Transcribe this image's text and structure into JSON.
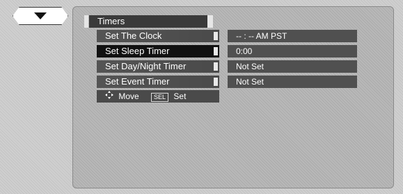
{
  "menu": {
    "title": "Timers",
    "items": [
      {
        "label": "Set The Clock",
        "value": "-- : -- AM PST",
        "selected": false
      },
      {
        "label": "Set Sleep Timer",
        "value": "0:00",
        "selected": true
      },
      {
        "label": "Set Day/Night Timer",
        "value": "Not Set",
        "selected": false
      },
      {
        "label": "Set Event Timer",
        "value": "Not Set",
        "selected": false
      }
    ]
  },
  "hint": {
    "move_label": "Move",
    "sel_key": "SEL",
    "set_label": "Set"
  },
  "icons": {
    "down_arrow": "chevron-down-icon",
    "move": "four-way-arrow-icon"
  },
  "colors": {
    "background": "#cfcfcf",
    "panel": "#b8b8b8",
    "item": "#4a4a4a",
    "item_selected": "#111111",
    "text": "#ffffff"
  }
}
